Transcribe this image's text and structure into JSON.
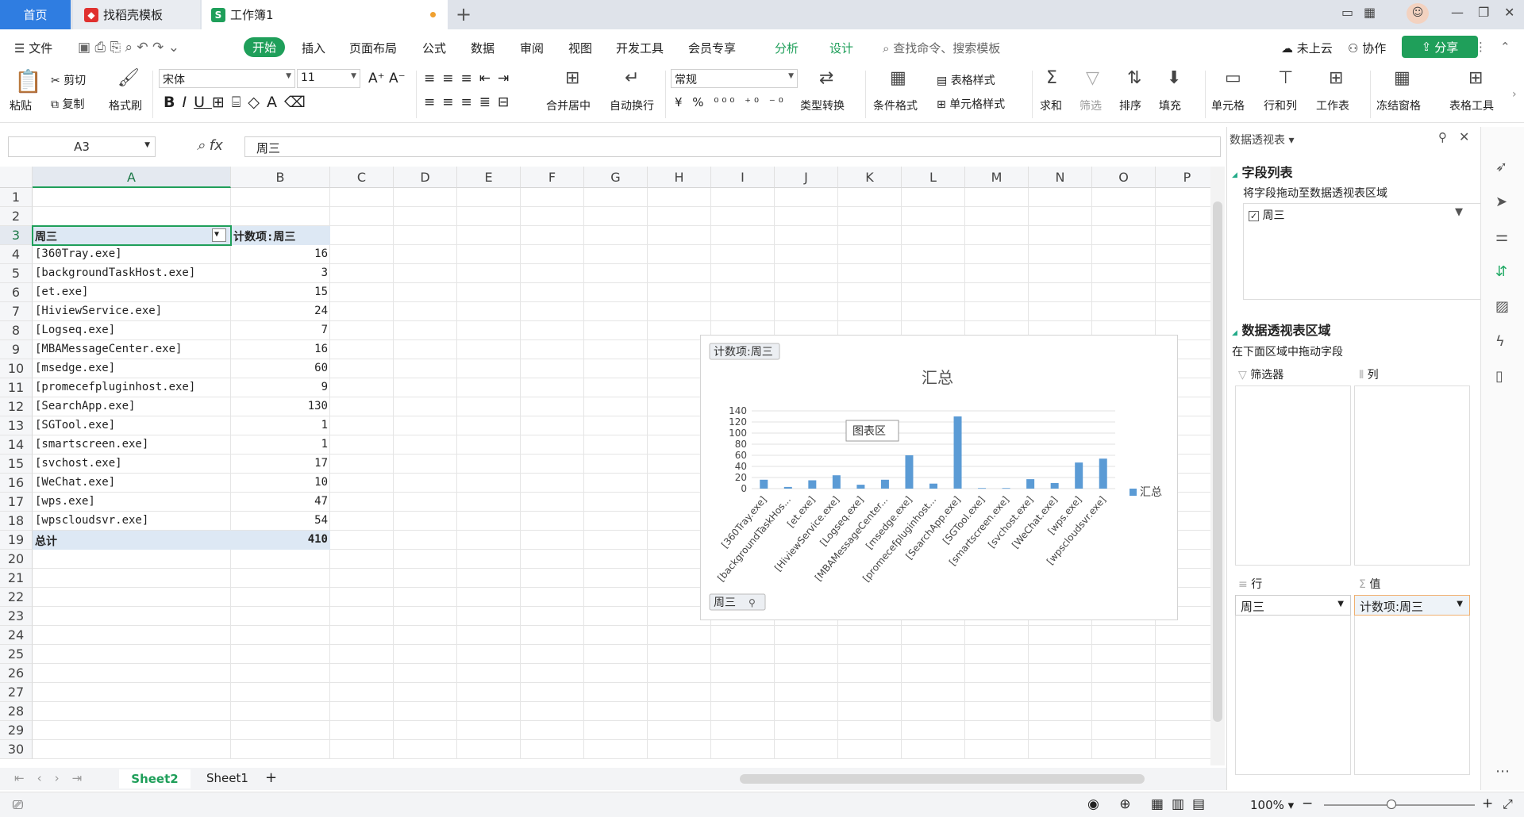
{
  "tabs": {
    "home": "首页",
    "docer": "找稻壳模板",
    "workbook": "工作簿1"
  },
  "menu": {
    "file": "文件",
    "items": [
      "开始",
      "插入",
      "页面布局",
      "公式",
      "数据",
      "审阅",
      "视图",
      "开发工具",
      "会员专享"
    ],
    "analyze": "分析",
    "design": "设计",
    "search": "查找命令、搜索模板",
    "cloud": "未上云",
    "collab": "协作",
    "share": "分享"
  },
  "ribbon": {
    "paste": "粘贴",
    "cut": "剪切",
    "copy": "复制",
    "format_painter": "格式刷",
    "font": "宋体",
    "size": "11",
    "number_format": "常规",
    "merge": "合并居中",
    "wrap": "自动换行",
    "convert": "类型转换",
    "cond_format": "条件格式",
    "table_style": "表格样式",
    "cell_style": "单元格样式",
    "sum": "求和",
    "filter": "筛选",
    "sort": "排序",
    "fill": "填充",
    "cell": "单元格",
    "rowcol": "行和列",
    "sheet": "工作表",
    "freeze": "冻结窗格",
    "tools": "表格工具"
  },
  "formula": {
    "namebox": "A3",
    "content": "周三"
  },
  "columns": [
    "A",
    "B",
    "C",
    "D",
    "E",
    "F",
    "G",
    "H",
    "I",
    "J",
    "K",
    "L",
    "M",
    "N",
    "O",
    "P"
  ],
  "rows": [
    "1",
    "2",
    "3",
    "4",
    "5",
    "6",
    "7",
    "8",
    "9",
    "10",
    "11",
    "12",
    "13",
    "14",
    "15",
    "16",
    "17",
    "18",
    "19",
    "20",
    "21",
    "22",
    "23",
    "24",
    "25",
    "26",
    "27",
    "28",
    "29",
    "30"
  ],
  "pivot": {
    "header_a": "周三",
    "header_b": "计数项:周三",
    "items": [
      {
        "name": "[360Tray.exe]",
        "count": "16"
      },
      {
        "name": "[backgroundTaskHost.exe]",
        "count": "3"
      },
      {
        "name": "[et.exe]",
        "count": "15"
      },
      {
        "name": "[HiviewService.exe]",
        "count": "24"
      },
      {
        "name": "[Logseq.exe]",
        "count": "7"
      },
      {
        "name": "[MBAMessageCenter.exe]",
        "count": "16"
      },
      {
        "name": "[msedge.exe]",
        "count": "60"
      },
      {
        "name": "[promecefpluginhost.exe]",
        "count": "9"
      },
      {
        "name": "[SearchApp.exe]",
        "count": "130"
      },
      {
        "name": "[SGTool.exe]",
        "count": "1"
      },
      {
        "name": "[smartscreen.exe]",
        "count": "1"
      },
      {
        "name": "[svchost.exe]",
        "count": "17"
      },
      {
        "name": "[WeChat.exe]",
        "count": "10"
      },
      {
        "name": "[wps.exe]",
        "count": "47"
      },
      {
        "name": "[wpscloudsvr.exe]",
        "count": "54"
      }
    ],
    "total_label": "总计",
    "total": "410"
  },
  "chart_data": {
    "type": "bar",
    "title": "汇总",
    "categories": [
      "[360Tray.exe]",
      "[backgroundTaskHos...",
      "[et.exe]",
      "[HiviewService.exe]",
      "[Logseq.exe]",
      "[MBAMessageCenter...",
      "[msedge.exe]",
      "[promecefpluginhost...",
      "[SearchApp.exe]",
      "[SGTool.exe]",
      "[smartscreen.exe]",
      "[svchost.exe]",
      "[WeChat.exe]",
      "[wps.exe]",
      "[wpscloudsvr.exe]"
    ],
    "series": [
      {
        "name": "汇总",
        "values": [
          16,
          3,
          15,
          24,
          7,
          16,
          60,
          9,
          130,
          1,
          1,
          17,
          10,
          47,
          54
        ]
      }
    ],
    "yticks": [
      "140",
      "120",
      "100",
      "80",
      "60",
      "40",
      "20",
      "0"
    ],
    "ylim": [
      0,
      140
    ],
    "legend": "right",
    "field_button": "计数项:周三",
    "axis_button": "周三",
    "tooltip": "图表区",
    "color": "#5b9bd5"
  },
  "sheets": {
    "active": "Sheet2",
    "other": "Sheet1"
  },
  "status": {
    "zoom": "100%"
  },
  "pane": {
    "title": "数据透视表",
    "fields_title": "字段列表",
    "fields_hint": "将字段拖动至数据透视表区域",
    "field": "周三",
    "area_title": "数据透视表区域",
    "area_hint": "在下面区域中拖动字段",
    "filter": "筛选器",
    "col": "列",
    "row": "行",
    "val": "值",
    "row_field": "周三",
    "val_field": "计数项:周三"
  }
}
